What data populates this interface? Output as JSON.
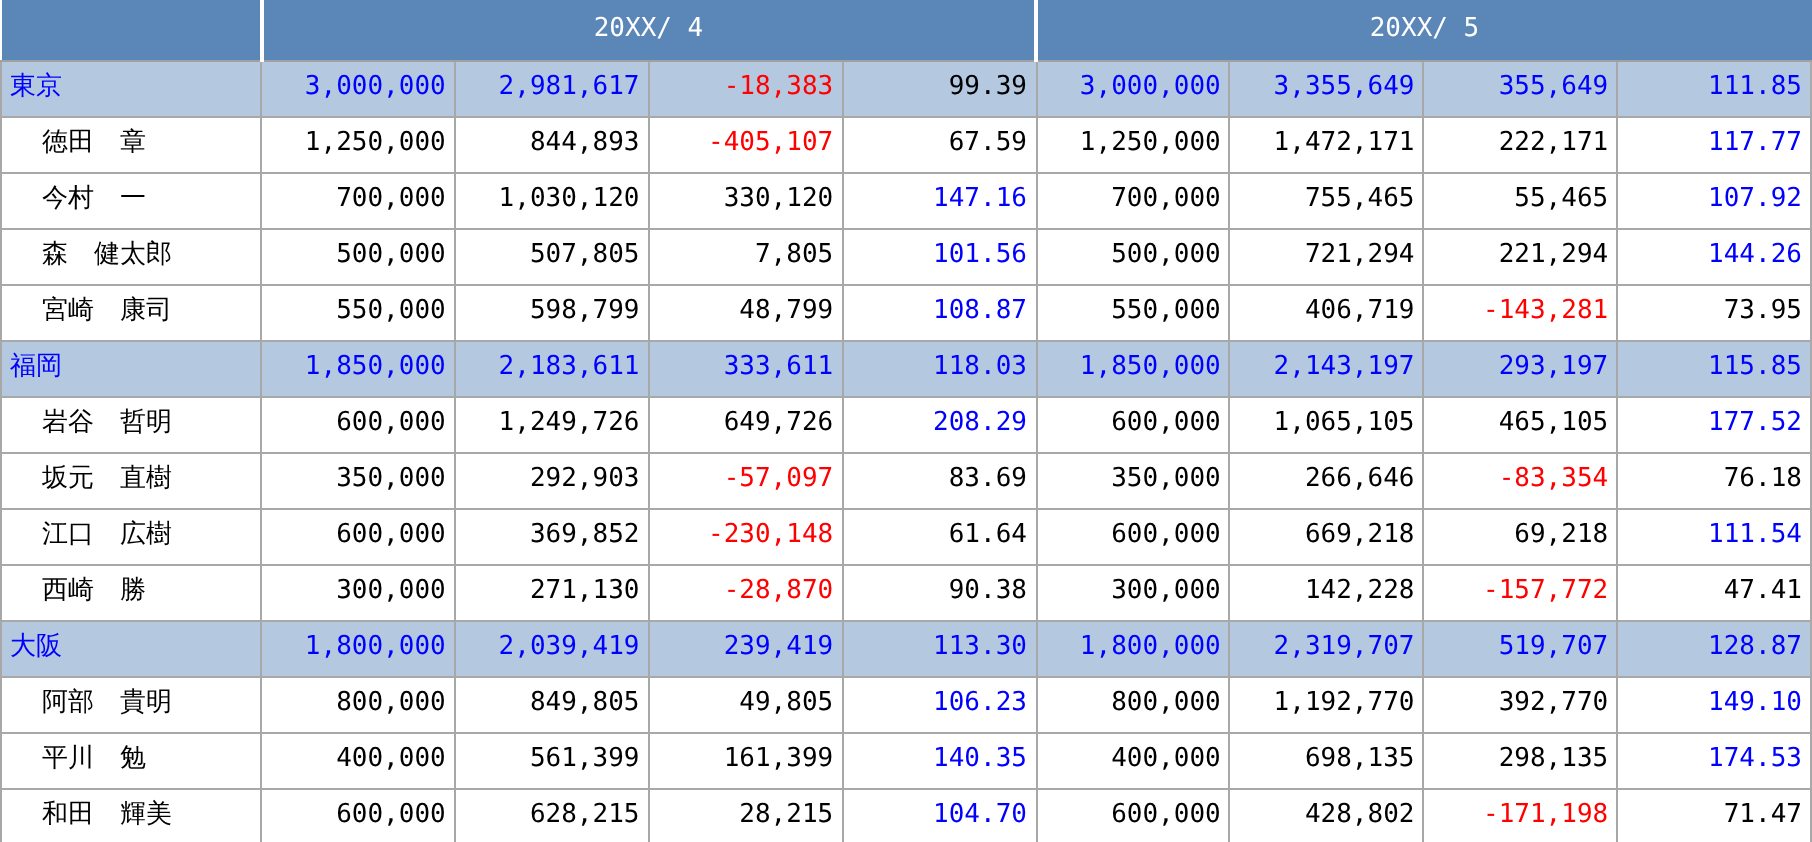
{
  "table": {
    "column_groups": [
      "20XX/ 4",
      "20XX/ 5"
    ],
    "rows": [
      {
        "kind": "group",
        "name": "東京",
        "cells": [
          {
            "v": "3,000,000",
            "color": "#0000ff"
          },
          {
            "v": "2,981,617",
            "color": "#0000ff"
          },
          {
            "v": "-18,383",
            "color": "#ff0000"
          },
          {
            "v": "99.39",
            "color": "#000000"
          },
          {
            "v": "3,000,000",
            "color": "#0000ff"
          },
          {
            "v": "3,355,649",
            "color": "#0000ff"
          },
          {
            "v": "355,649",
            "color": "#0000ff"
          },
          {
            "v": "111.85",
            "color": "#0000ff"
          }
        ]
      },
      {
        "kind": "member",
        "name": "徳田　章",
        "cells": [
          {
            "v": "1,250,000",
            "color": "#000000"
          },
          {
            "v": "844,893",
            "color": "#000000"
          },
          {
            "v": "-405,107",
            "color": "#ff0000"
          },
          {
            "v": "67.59",
            "color": "#000000"
          },
          {
            "v": "1,250,000",
            "color": "#000000"
          },
          {
            "v": "1,472,171",
            "color": "#000000"
          },
          {
            "v": "222,171",
            "color": "#000000"
          },
          {
            "v": "117.77",
            "color": "#0000ff"
          }
        ]
      },
      {
        "kind": "member",
        "name": "今村　一",
        "cells": [
          {
            "v": "700,000",
            "color": "#000000"
          },
          {
            "v": "1,030,120",
            "color": "#000000"
          },
          {
            "v": "330,120",
            "color": "#000000"
          },
          {
            "v": "147.16",
            "color": "#0000ff"
          },
          {
            "v": "700,000",
            "color": "#000000"
          },
          {
            "v": "755,465",
            "color": "#000000"
          },
          {
            "v": "55,465",
            "color": "#000000"
          },
          {
            "v": "107.92",
            "color": "#0000ff"
          }
        ]
      },
      {
        "kind": "member",
        "name": "森　健太郎",
        "cells": [
          {
            "v": "500,000",
            "color": "#000000"
          },
          {
            "v": "507,805",
            "color": "#000000"
          },
          {
            "v": "7,805",
            "color": "#000000"
          },
          {
            "v": "101.56",
            "color": "#0000ff"
          },
          {
            "v": "500,000",
            "color": "#000000"
          },
          {
            "v": "721,294",
            "color": "#000000"
          },
          {
            "v": "221,294",
            "color": "#000000"
          },
          {
            "v": "144.26",
            "color": "#0000ff"
          }
        ]
      },
      {
        "kind": "member",
        "name": "宮崎　康司",
        "cells": [
          {
            "v": "550,000",
            "color": "#000000"
          },
          {
            "v": "598,799",
            "color": "#000000"
          },
          {
            "v": "48,799",
            "color": "#000000"
          },
          {
            "v": "108.87",
            "color": "#0000ff"
          },
          {
            "v": "550,000",
            "color": "#000000"
          },
          {
            "v": "406,719",
            "color": "#000000"
          },
          {
            "v": "-143,281",
            "color": "#ff0000"
          },
          {
            "v": "73.95",
            "color": "#000000"
          }
        ]
      },
      {
        "kind": "group",
        "name": "福岡",
        "cells": [
          {
            "v": "1,850,000",
            "color": "#0000ff"
          },
          {
            "v": "2,183,611",
            "color": "#0000ff"
          },
          {
            "v": "333,611",
            "color": "#0000ff"
          },
          {
            "v": "118.03",
            "color": "#0000ff"
          },
          {
            "v": "1,850,000",
            "color": "#0000ff"
          },
          {
            "v": "2,143,197",
            "color": "#0000ff"
          },
          {
            "v": "293,197",
            "color": "#0000ff"
          },
          {
            "v": "115.85",
            "color": "#0000ff"
          }
        ]
      },
      {
        "kind": "member",
        "name": "岩谷　哲明",
        "cells": [
          {
            "v": "600,000",
            "color": "#000000"
          },
          {
            "v": "1,249,726",
            "color": "#000000"
          },
          {
            "v": "649,726",
            "color": "#000000"
          },
          {
            "v": "208.29",
            "color": "#0000ff"
          },
          {
            "v": "600,000",
            "color": "#000000"
          },
          {
            "v": "1,065,105",
            "color": "#000000"
          },
          {
            "v": "465,105",
            "color": "#000000"
          },
          {
            "v": "177.52",
            "color": "#0000ff"
          }
        ]
      },
      {
        "kind": "member",
        "name": "坂元　直樹",
        "cells": [
          {
            "v": "350,000",
            "color": "#000000"
          },
          {
            "v": "292,903",
            "color": "#000000"
          },
          {
            "v": "-57,097",
            "color": "#ff0000"
          },
          {
            "v": "83.69",
            "color": "#000000"
          },
          {
            "v": "350,000",
            "color": "#000000"
          },
          {
            "v": "266,646",
            "color": "#000000"
          },
          {
            "v": "-83,354",
            "color": "#ff0000"
          },
          {
            "v": "76.18",
            "color": "#000000"
          }
        ]
      },
      {
        "kind": "member",
        "name": "江口　広樹",
        "cells": [
          {
            "v": "600,000",
            "color": "#000000"
          },
          {
            "v": "369,852",
            "color": "#000000"
          },
          {
            "v": "-230,148",
            "color": "#ff0000"
          },
          {
            "v": "61.64",
            "color": "#000000"
          },
          {
            "v": "600,000",
            "color": "#000000"
          },
          {
            "v": "669,218",
            "color": "#000000"
          },
          {
            "v": "69,218",
            "color": "#000000"
          },
          {
            "v": "111.54",
            "color": "#0000ff"
          }
        ]
      },
      {
        "kind": "member",
        "name": "西崎　勝",
        "cells": [
          {
            "v": "300,000",
            "color": "#000000"
          },
          {
            "v": "271,130",
            "color": "#000000"
          },
          {
            "v": "-28,870",
            "color": "#ff0000"
          },
          {
            "v": "90.38",
            "color": "#000000"
          },
          {
            "v": "300,000",
            "color": "#000000"
          },
          {
            "v": "142,228",
            "color": "#000000"
          },
          {
            "v": "-157,772",
            "color": "#ff0000"
          },
          {
            "v": "47.41",
            "color": "#000000"
          }
        ]
      },
      {
        "kind": "group",
        "name": "大阪",
        "cells": [
          {
            "v": "1,800,000",
            "color": "#0000ff"
          },
          {
            "v": "2,039,419",
            "color": "#0000ff"
          },
          {
            "v": "239,419",
            "color": "#0000ff"
          },
          {
            "v": "113.30",
            "color": "#0000ff"
          },
          {
            "v": "1,800,000",
            "color": "#0000ff"
          },
          {
            "v": "2,319,707",
            "color": "#0000ff"
          },
          {
            "v": "519,707",
            "color": "#0000ff"
          },
          {
            "v": "128.87",
            "color": "#0000ff"
          }
        ]
      },
      {
        "kind": "member",
        "name": "阿部　貴明",
        "cells": [
          {
            "v": "800,000",
            "color": "#000000"
          },
          {
            "v": "849,805",
            "color": "#000000"
          },
          {
            "v": "49,805",
            "color": "#000000"
          },
          {
            "v": "106.23",
            "color": "#0000ff"
          },
          {
            "v": "800,000",
            "color": "#000000"
          },
          {
            "v": "1,192,770",
            "color": "#000000"
          },
          {
            "v": "392,770",
            "color": "#000000"
          },
          {
            "v": "149.10",
            "color": "#0000ff"
          }
        ]
      },
      {
        "kind": "member",
        "name": "平川　勉",
        "cells": [
          {
            "v": "400,000",
            "color": "#000000"
          },
          {
            "v": "561,399",
            "color": "#000000"
          },
          {
            "v": "161,399",
            "color": "#000000"
          },
          {
            "v": "140.35",
            "color": "#0000ff"
          },
          {
            "v": "400,000",
            "color": "#000000"
          },
          {
            "v": "698,135",
            "color": "#000000"
          },
          {
            "v": "298,135",
            "color": "#000000"
          },
          {
            "v": "174.53",
            "color": "#0000ff"
          }
        ]
      },
      {
        "kind": "member",
        "name": "和田　輝美",
        "cells": [
          {
            "v": "600,000",
            "color": "#000000"
          },
          {
            "v": "628,215",
            "color": "#000000"
          },
          {
            "v": "28,215",
            "color": "#000000"
          },
          {
            "v": "104.70",
            "color": "#0000ff"
          },
          {
            "v": "600,000",
            "color": "#000000"
          },
          {
            "v": "428,802",
            "color": "#000000"
          },
          {
            "v": "-171,198",
            "color": "#ff0000"
          },
          {
            "v": "71.47",
            "color": "#000000"
          }
        ]
      }
    ]
  }
}
